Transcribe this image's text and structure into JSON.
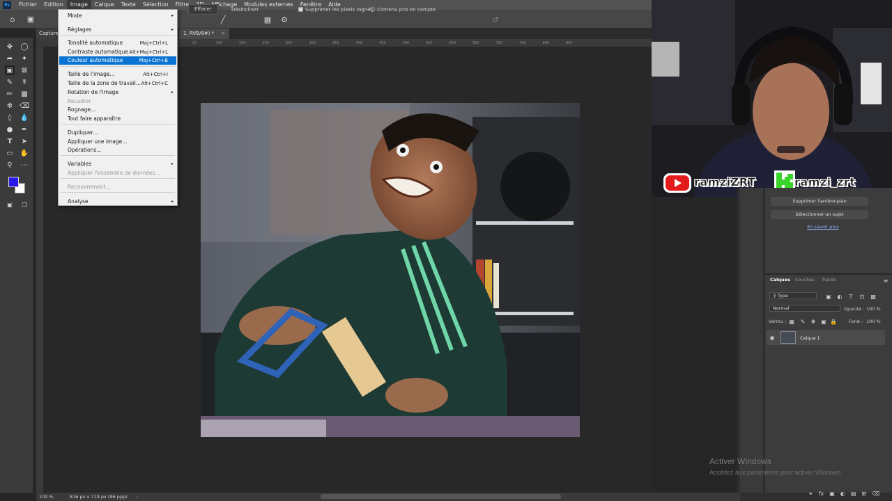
{
  "app": {
    "logo": "Ps"
  },
  "menubar": {
    "items": [
      "Fichier",
      "Edition",
      "Image",
      "Calque",
      "Texte",
      "Sélection",
      "Filtre",
      "3D",
      "Affichage",
      "Modules externes",
      "Fenêtre",
      "Aide"
    ],
    "active": "Image"
  },
  "options": {
    "effacer": "Effacer",
    "desincliner": "Désincliner",
    "delete_cropped": "Supprimer les pixels rognés",
    "content_aware": "Contenu pris en compte"
  },
  "tabs": {
    "doc1": "Capture",
    "doc2": "1, RVB/8#) *"
  },
  "ruler": {
    "ticks": [
      "50",
      "100",
      "150",
      "200",
      "250",
      "300",
      "350",
      "400",
      "450",
      "500",
      "550",
      "600",
      "650",
      "700",
      "750",
      "800",
      "850"
    ]
  },
  "image_menu": {
    "items": [
      {
        "label": "Mode",
        "shortcut": "",
        "submenu": true,
        "disabled": false
      },
      {
        "label": "Réglages",
        "shortcut": "",
        "submenu": true,
        "disabled": false
      },
      {
        "label": "Tonalité automatique",
        "shortcut": "Maj+Ctrl+L",
        "submenu": false,
        "disabled": false
      },
      {
        "label": "Contraste automatique",
        "shortcut": "Alt+Maj+Ctrl+L",
        "submenu": false,
        "disabled": false
      },
      {
        "label": "Couleur automatique",
        "shortcut": "Maj+Ctrl+B",
        "submenu": false,
        "disabled": false,
        "highlighted": true
      },
      {
        "label": "Taille de l'image...",
        "shortcut": "Alt+Ctrl+I",
        "submenu": false,
        "disabled": false
      },
      {
        "label": "Taille de la zone de travail...",
        "shortcut": "Alt+Ctrl+C",
        "submenu": false,
        "disabled": false
      },
      {
        "label": "Rotation de l'image",
        "shortcut": "",
        "submenu": true,
        "disabled": false
      },
      {
        "label": "Recadrer",
        "shortcut": "",
        "submenu": false,
        "disabled": true
      },
      {
        "label": "Rognage...",
        "shortcut": "",
        "submenu": false,
        "disabled": false
      },
      {
        "label": "Tout faire apparaître",
        "shortcut": "",
        "submenu": false,
        "disabled": false
      },
      {
        "label": "Dupliquer...",
        "shortcut": "",
        "submenu": false,
        "disabled": false
      },
      {
        "label": "Appliquer une image...",
        "shortcut": "",
        "submenu": false,
        "disabled": false
      },
      {
        "label": "Opérations...",
        "shortcut": "",
        "submenu": false,
        "disabled": false
      },
      {
        "label": "Variables",
        "shortcut": "",
        "submenu": true,
        "disabled": false
      },
      {
        "label": "Appliquer l'ensemble de données...",
        "shortcut": "",
        "submenu": false,
        "disabled": true
      },
      {
        "label": "Recouvrement...",
        "shortcut": "",
        "submenu": false,
        "disabled": true
      },
      {
        "label": "Analyse",
        "shortcut": "",
        "submenu": true,
        "disabled": false
      }
    ]
  },
  "overlay": {
    "youtube": "ramziZRT",
    "kick": "ramzi_zrt"
  },
  "properties": {
    "remove_bg": "Supprimer l'arrière-plan",
    "select_subject": "Sélectionner un sujet",
    "learn_more": "En savoir plus"
  },
  "layers": {
    "tabs": [
      "Calques",
      "Couches",
      "Tracés"
    ],
    "filter": "Type",
    "blend_mode": "Normal",
    "opacity_label": "Opacité :",
    "opacity": "100 %",
    "lock_label": "Verrou :",
    "fill_label": "Fond :",
    "fill": "100 %",
    "layer_name": "Calque 1"
  },
  "status": {
    "zoom": "100 %",
    "doc_info": "816 px x 719 px (96 ppp)"
  },
  "watermark": {
    "title": "Activer Windows",
    "subtitle": "Accédez aux paramètres pour activer Windows."
  },
  "colors": {
    "foreground": "#2a1ae6",
    "background": "#ffffff",
    "highlight": "#0a74d4"
  }
}
